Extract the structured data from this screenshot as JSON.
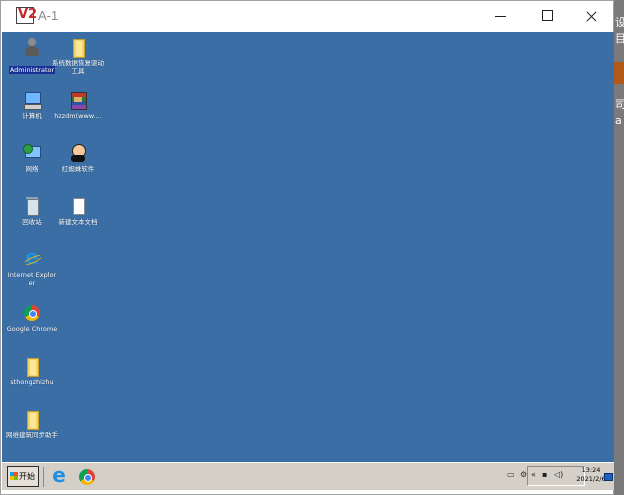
{
  "window": {
    "app_logo": "V2",
    "title": "A-1",
    "controls": [
      "minimize",
      "maximize",
      "close"
    ]
  },
  "right_edge_fragments": [
    "设",
    "目",
    "司",
    "a"
  ],
  "desktop": {
    "background_color": "#3a6ea5",
    "icons": [
      {
        "label": "Administrator",
        "icon": "user-folder-icon",
        "selected": true
      },
      {
        "label": "系统数据恢复驱动工具",
        "icon": "folder-icon"
      },
      {
        "label": "计算机",
        "icon": "computer-icon"
      },
      {
        "label": "hzzdm(www....",
        "icon": "winrar-icon"
      },
      {
        "label": "网络",
        "icon": "network-icon"
      },
      {
        "label": "红蜘蛛软件",
        "icon": "red-spider-icon"
      },
      {
        "label": "回收站",
        "icon": "recycle-bin-icon"
      },
      {
        "label": "新建文本文档",
        "icon": "text-document-icon"
      },
      {
        "label": "Internet Explorer",
        "icon": "internet-explorer-icon"
      },
      {
        "label": "Google Chrome",
        "icon": "chrome-icon"
      },
      {
        "label": "sthongzhizhu",
        "icon": "folder-icon"
      },
      {
        "label": "网维建筑同步助手",
        "icon": "folder-icon"
      }
    ]
  },
  "taskbar": {
    "start_label": "开始",
    "pinned": [
      "internet-explorer-icon",
      "chrome-icon"
    ],
    "tray_text": "«",
    "clock_time": "13:24",
    "clock_date": "2021/2/6"
  }
}
